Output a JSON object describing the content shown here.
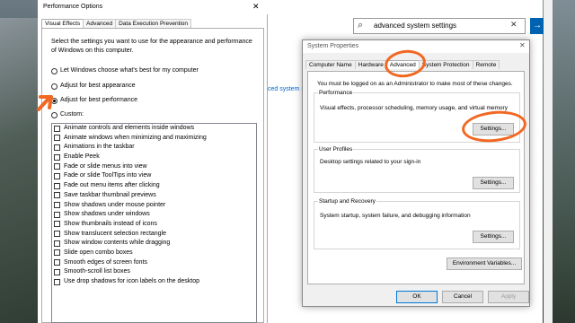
{
  "explorer": {
    "search_text": "advanced system settings",
    "result_link": "ced system se"
  },
  "perf_window": {
    "title": "Performance Options",
    "tabs": [
      "Visual Effects",
      "Advanced",
      "Data Execution Prevention"
    ],
    "description": "Select the settings you want to use for the appearance and performance of Windows on this computer.",
    "radios": [
      {
        "label": "Let Windows choose what's best for my computer",
        "selected": false
      },
      {
        "label": "Adjust for best appearance",
        "selected": false
      },
      {
        "label": "Adjust for best performance",
        "selected": true
      },
      {
        "label": "Custom:",
        "selected": false
      }
    ],
    "checkboxes": [
      "Animate controls and elements inside windows",
      "Animate windows when minimizing and maximizing",
      "Animations in the taskbar",
      "Enable Peek",
      "Fade or slide menus into view",
      "Fade or slide ToolTips into view",
      "Fade out menu items after clicking",
      "Save taskbar thumbnail previews",
      "Show shadows under mouse pointer",
      "Show shadows under windows",
      "Show thumbnails instead of icons",
      "Show translucent selection rectangle",
      "Show window contents while dragging",
      "Slide open combo boxes",
      "Smooth edges of screen fonts",
      "Smooth-scroll list boxes",
      "Use drop shadows for icon labels on the desktop"
    ]
  },
  "sys_window": {
    "title": "System Properties",
    "tabs": [
      "Computer Name",
      "Hardware",
      "Advanced",
      "System Protection",
      "Remote"
    ],
    "admin_note": "You must be logged on as an Administrator to make most of these changes.",
    "performance": {
      "legend": "Performance",
      "text": "Visual effects, processor scheduling, memory usage, and virtual memory",
      "button": "Settings..."
    },
    "profiles": {
      "legend": "User Profiles",
      "text": "Desktop settings related to your sign-in",
      "button": "Settings..."
    },
    "startup": {
      "legend": "Startup and Recovery",
      "text": "System startup, system failure, and debugging information",
      "button": "Settings..."
    },
    "env_button": "Environment Variables...",
    "ok": "OK",
    "cancel": "Cancel",
    "apply": "Apply"
  },
  "colors": {
    "annotation": "#f26722",
    "accent": "#0063b1"
  }
}
